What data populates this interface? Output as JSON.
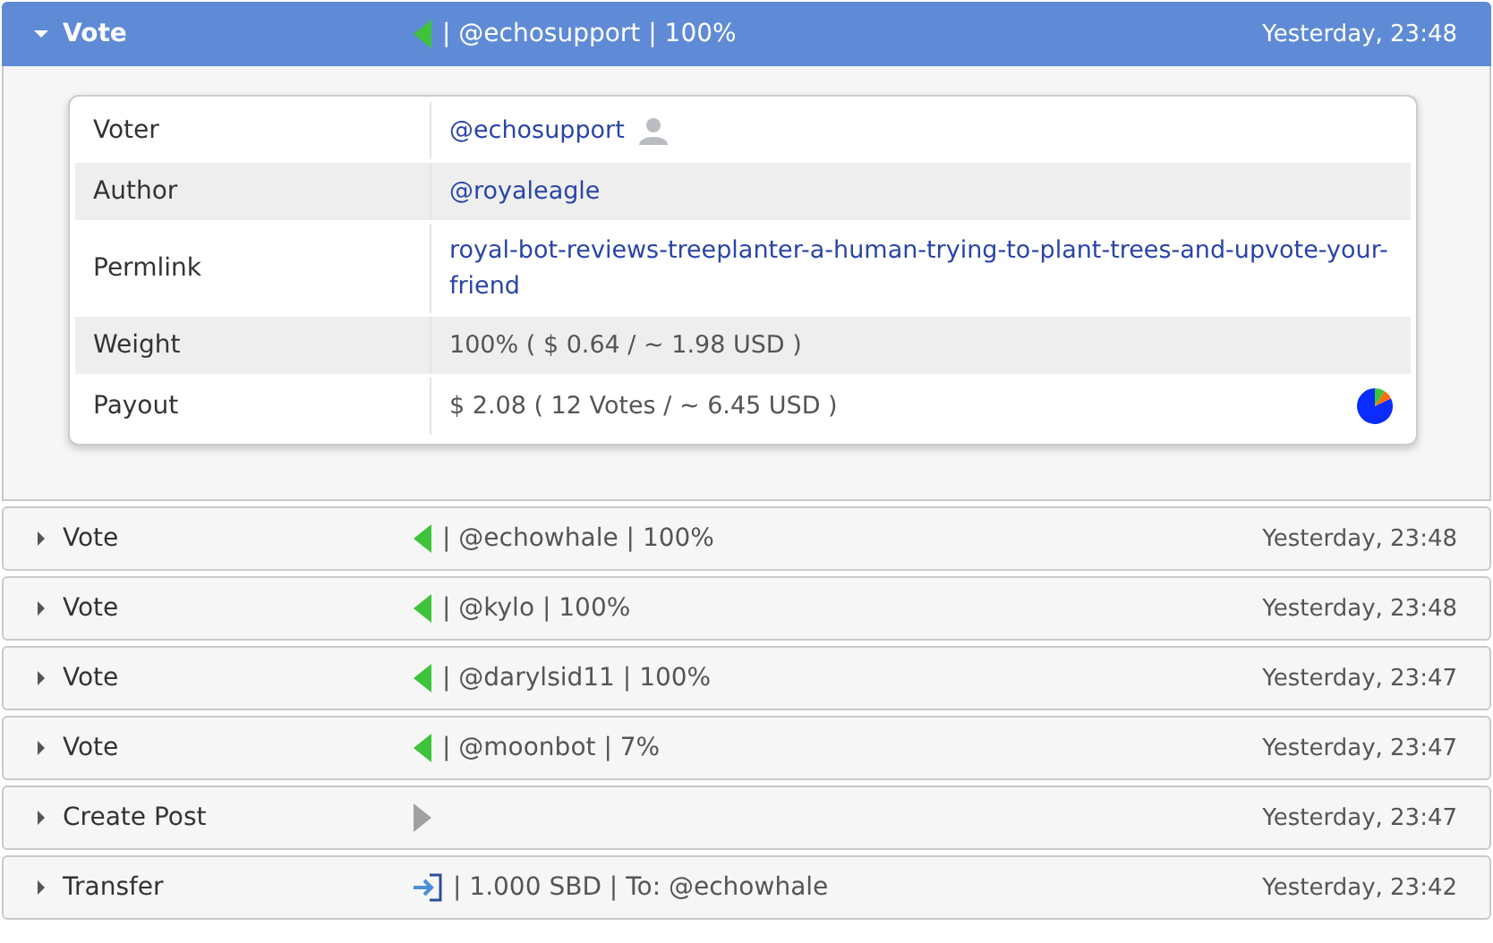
{
  "items": [
    {
      "title": "Vote",
      "kind": "vote",
      "summary": "| @echosupport | 100%",
      "time": "Yesterday, 23:48",
      "expanded": true,
      "details": [
        {
          "label": "Voter",
          "value": "@echosupport",
          "kind": "user"
        },
        {
          "label": "Author",
          "value": "@royaleagle",
          "kind": "link"
        },
        {
          "label": "Permlink",
          "value": "royal-bot-reviews-treeplanter-a-human-trying-to-plant-trees-and-upvote-your-friend",
          "kind": "link"
        },
        {
          "label": "Weight",
          "value": "100% ( $ 0.64 / ~ 1.98 USD )",
          "kind": "text"
        },
        {
          "label": "Payout",
          "value": "$ 2.08 ( 12 Votes / ~ 6.45 USD )",
          "kind": "payout"
        }
      ]
    },
    {
      "title": "Vote",
      "kind": "vote",
      "summary": "| @echowhale | 100%",
      "time": "Yesterday, 23:48",
      "expanded": false
    },
    {
      "title": "Vote",
      "kind": "vote",
      "summary": "| @kylo | 100%",
      "time": "Yesterday, 23:48",
      "expanded": false
    },
    {
      "title": "Vote",
      "kind": "vote",
      "summary": "| @darylsid11 | 100%",
      "time": "Yesterday, 23:47",
      "expanded": false
    },
    {
      "title": "Vote",
      "kind": "vote",
      "summary": "| @moonbot | 7%",
      "time": "Yesterday, 23:47",
      "expanded": false
    },
    {
      "title": "Create Post",
      "kind": "post",
      "time": "Yesterday, 23:47",
      "expanded": false
    },
    {
      "title": "Transfer",
      "kind": "transfer",
      "summary": "| 1.000 SBD | To: @echowhale",
      "time": "Yesterday, 23:42",
      "expanded": false
    }
  ]
}
